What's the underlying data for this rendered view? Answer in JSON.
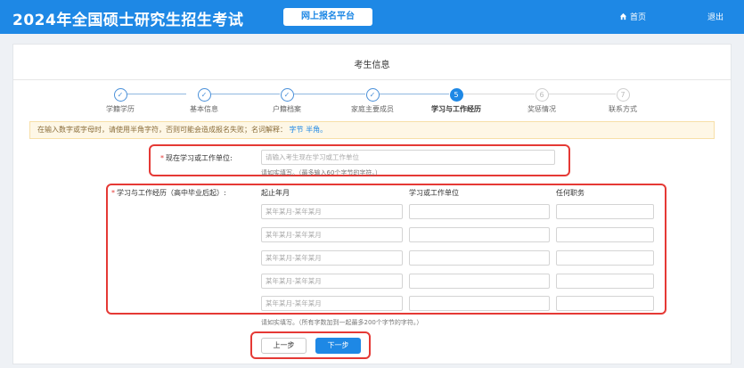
{
  "header": {
    "title": "2024年全国硕士研究生招生考试",
    "platform": "网上报名平台",
    "home_label": "首页",
    "logout_label": "退出"
  },
  "page": {
    "title": "考生信息"
  },
  "steps": [
    {
      "label": "学籍学历",
      "state": "done",
      "symbol": "✓"
    },
    {
      "label": "基本信息",
      "state": "done",
      "symbol": "✓"
    },
    {
      "label": "户籍档案",
      "state": "done",
      "symbol": "✓"
    },
    {
      "label": "家庭主要成员",
      "state": "done",
      "symbol": "✓"
    },
    {
      "label": "学习与工作经历",
      "state": "active",
      "symbol": "5"
    },
    {
      "label": "奖惩情况",
      "state": "todo",
      "symbol": "6"
    },
    {
      "label": "联系方式",
      "state": "todo",
      "symbol": "7"
    }
  ],
  "notice": {
    "text": "在输入数字或字母时，请使用半角字符，否则可能会造成报名失败；名词解释：",
    "link_1": "字节",
    "link_2": "半角。"
  },
  "current_unit": {
    "label": "现在学习或工作单位:",
    "required_mark": "*",
    "placeholder": "请输入考生现在学习或工作单位",
    "hint": "请如实填写。（最多输入60个字节的字符。）"
  },
  "history": {
    "label": "学习与工作经历（高中毕业后起）:",
    "required_mark": "*",
    "columns": [
      "起止年月",
      "学习或工作单位",
      "任何职务"
    ],
    "date_placeholder": "某年某月-某年某月",
    "row_count": 5,
    "hint": "请如实填写。（所有字数加到一起最多200个字节的字符。）"
  },
  "buttons": {
    "prev": "上一步",
    "next": "下一步"
  },
  "colors": {
    "primary": "#1e88e5",
    "highlight": "#e53935",
    "notice_bg": "#fef7e6"
  }
}
